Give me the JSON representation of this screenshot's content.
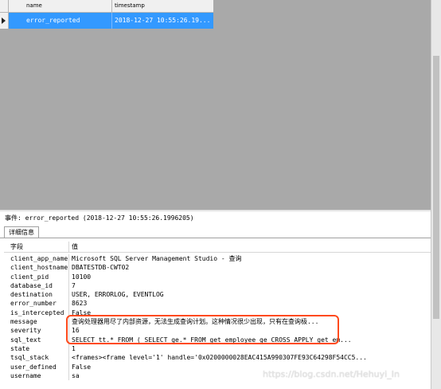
{
  "grid": {
    "columns": [
      "name",
      "timestamp"
    ],
    "rows": [
      {
        "name": "error_reported",
        "timestamp": "2018-12-27 10:55:26.19..."
      }
    ]
  },
  "event_line": "事件: error_reported (2018-12-27 10:55:26.1996205)",
  "tab_label": "详细信息",
  "details": {
    "field_header": "字段",
    "value_header": "值",
    "rows": [
      {
        "field": "client_app_name",
        "value": "Microsoft SQL Server Management Studio - 查询"
      },
      {
        "field": "client_hostname",
        "value": "DBATESTDB-CWT02"
      },
      {
        "field": "client_pid",
        "value": "10100"
      },
      {
        "field": "database_id",
        "value": "7"
      },
      {
        "field": "destination",
        "value": "USER, ERRORLOG, EVENTLOG"
      },
      {
        "field": "error_number",
        "value": "8623"
      },
      {
        "field": "is_intercepted",
        "value": "False"
      },
      {
        "field": "message",
        "value": "查询处理器用尽了内部资源，无法生成查询计划。这种情况很少出现，只有在查询极..."
      },
      {
        "field": "severity",
        "value": "16"
      },
      {
        "field": "sql_text",
        "value": "SELECT tt.* FROM  (  SELECT ge.* FROM get_employee ge  CROSS APPLY get_em..."
      },
      {
        "field": "state",
        "value": "1"
      },
      {
        "field": "tsql_stack",
        "value": "<frames><frame level='1' handle='0x0200000028EAC415A990307FE93C64298F54CC5..."
      },
      {
        "field": "user_defined",
        "value": "False"
      },
      {
        "field": "username",
        "value": "sa"
      }
    ]
  },
  "watermark": "https://blog.csdn.net/Hehuyi_In",
  "colors": {
    "selection": "#3399ff",
    "highlight_border": "#ff4a1c",
    "grid_background": "#a9a9a9"
  }
}
